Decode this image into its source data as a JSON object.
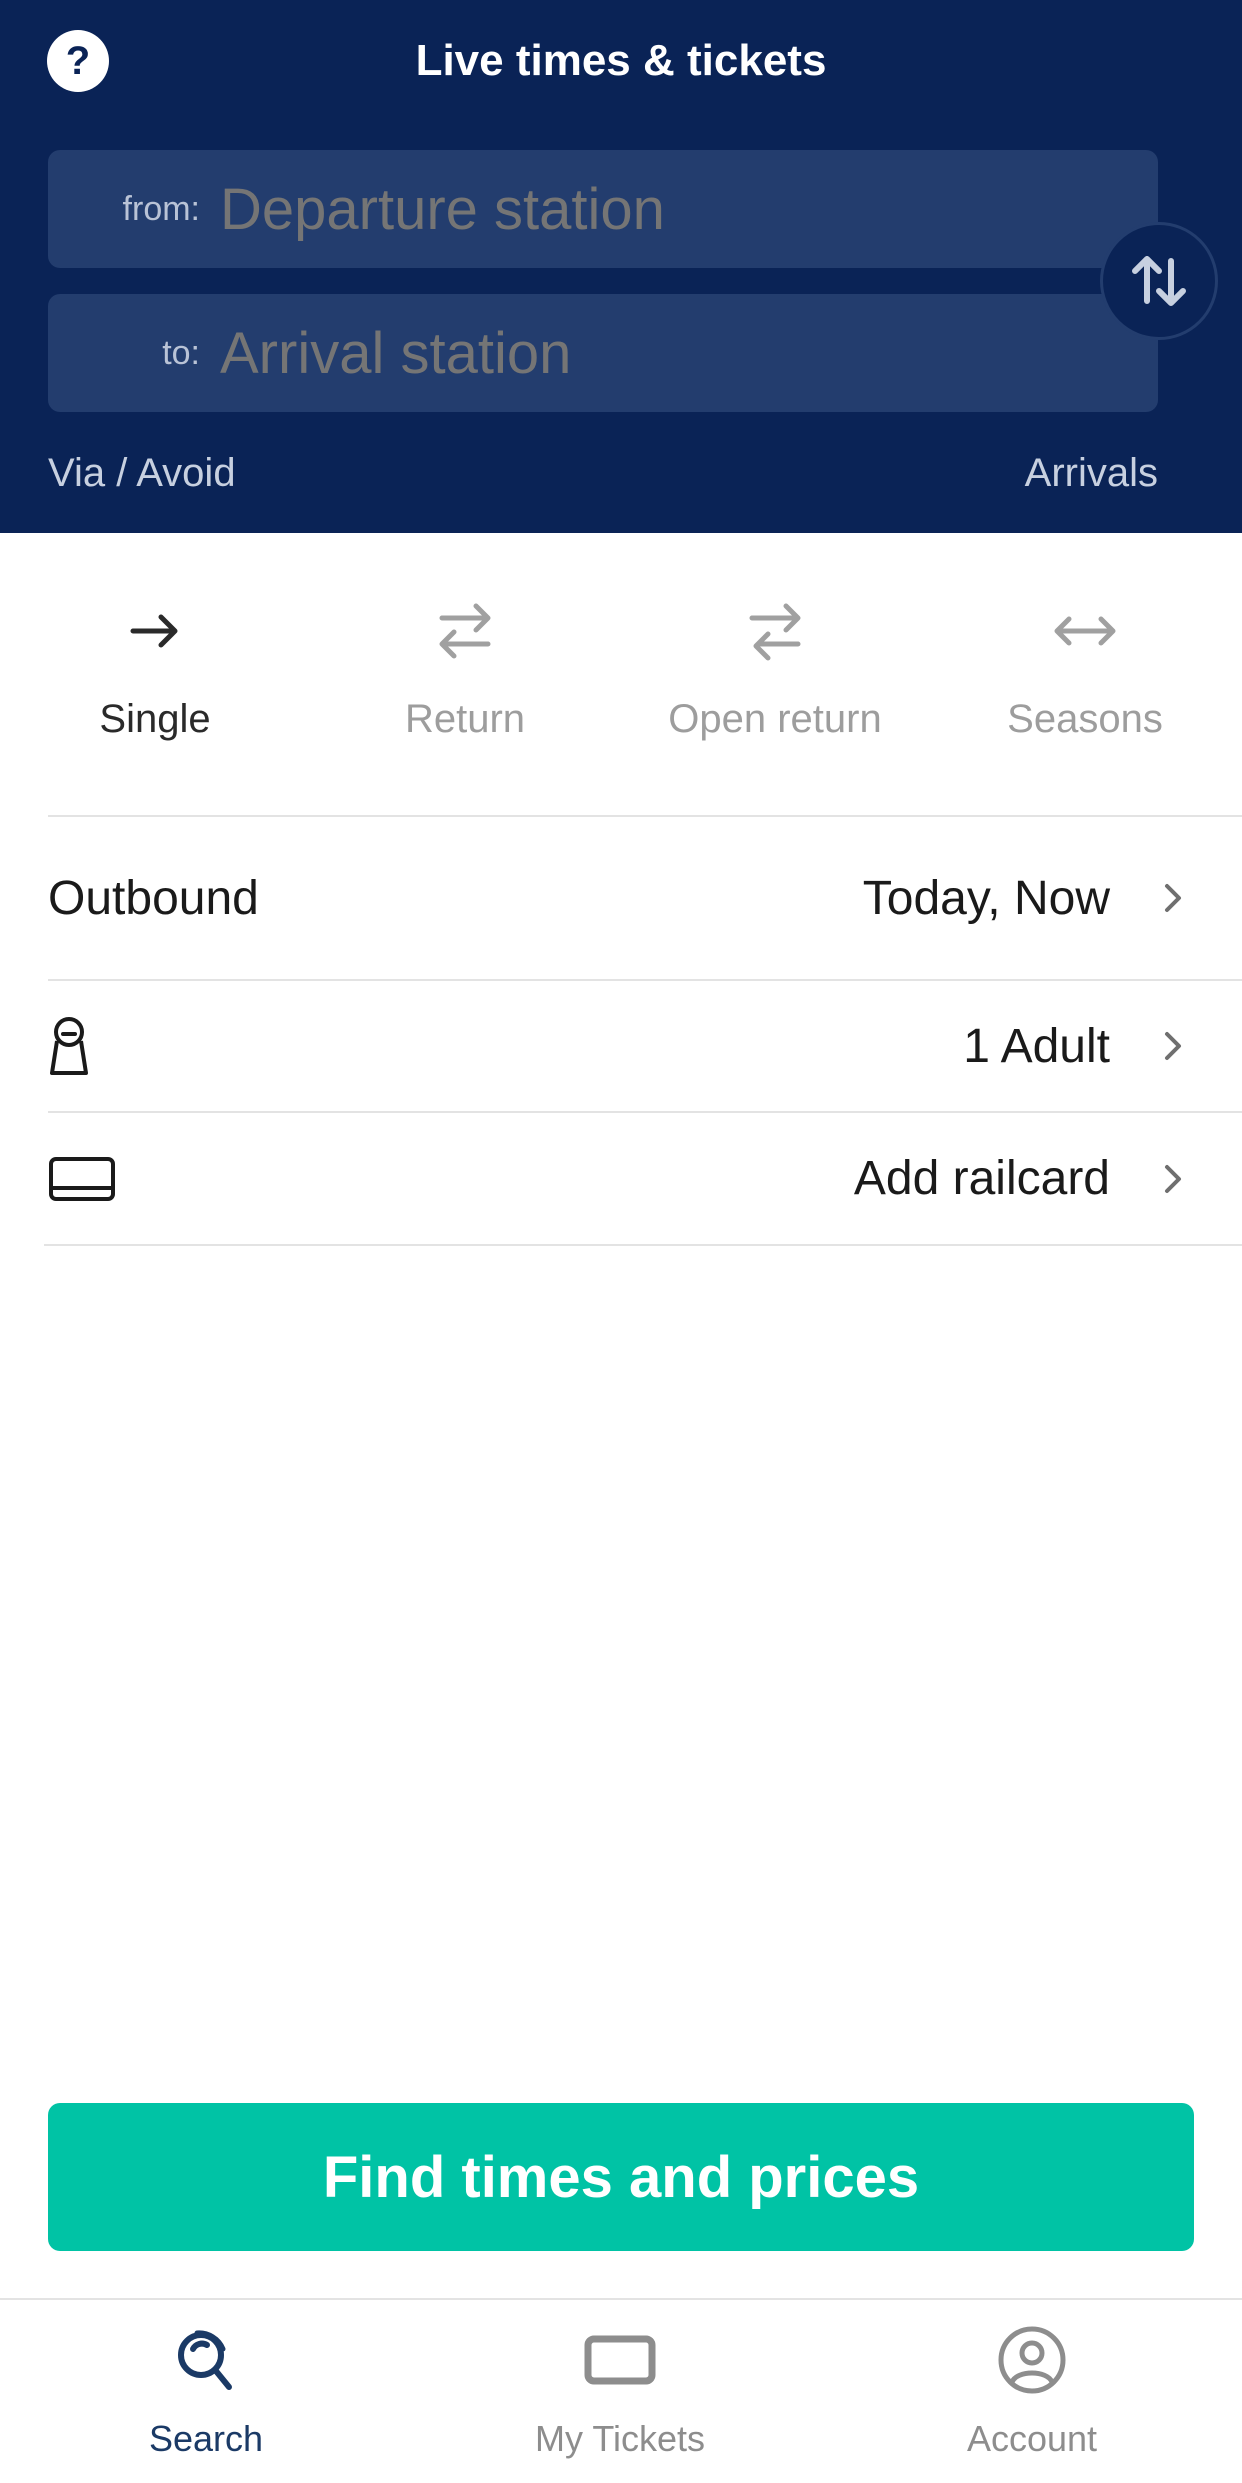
{
  "header": {
    "title": "Live times & tickets",
    "help_icon": "question-icon",
    "from_label": "from:",
    "from_placeholder": "Departure station",
    "to_label": "to:",
    "to_placeholder": "Arrival station",
    "via_avoid": "Via / Avoid",
    "arrivals": "Arrivals"
  },
  "ticket_types": [
    {
      "label": "Single",
      "icon": "arrow-right-icon",
      "active": true
    },
    {
      "label": "Return",
      "icon": "return-arrows-icon",
      "active": false
    },
    {
      "label": "Open return",
      "icon": "open-return-icon",
      "active": false
    },
    {
      "label": "Seasons",
      "icon": "double-arrow-icon",
      "active": false
    }
  ],
  "options": {
    "outbound_label": "Outbound",
    "outbound_value": "Today, Now",
    "passengers_value": "1 Adult",
    "railcard_value": "Add railcard"
  },
  "cta": {
    "label": "Find times and prices"
  },
  "tabbar": [
    {
      "label": "Search",
      "icon": "search-icon",
      "active": true
    },
    {
      "label": "My Tickets",
      "icon": "ticket-icon",
      "active": false
    },
    {
      "label": "Account",
      "icon": "account-icon",
      "active": false
    }
  ],
  "colors": {
    "header_bg": "#0a2356",
    "field_bg": "#233d6e",
    "cta_bg": "#00c3a5",
    "active_tab": "#1b3a66"
  }
}
